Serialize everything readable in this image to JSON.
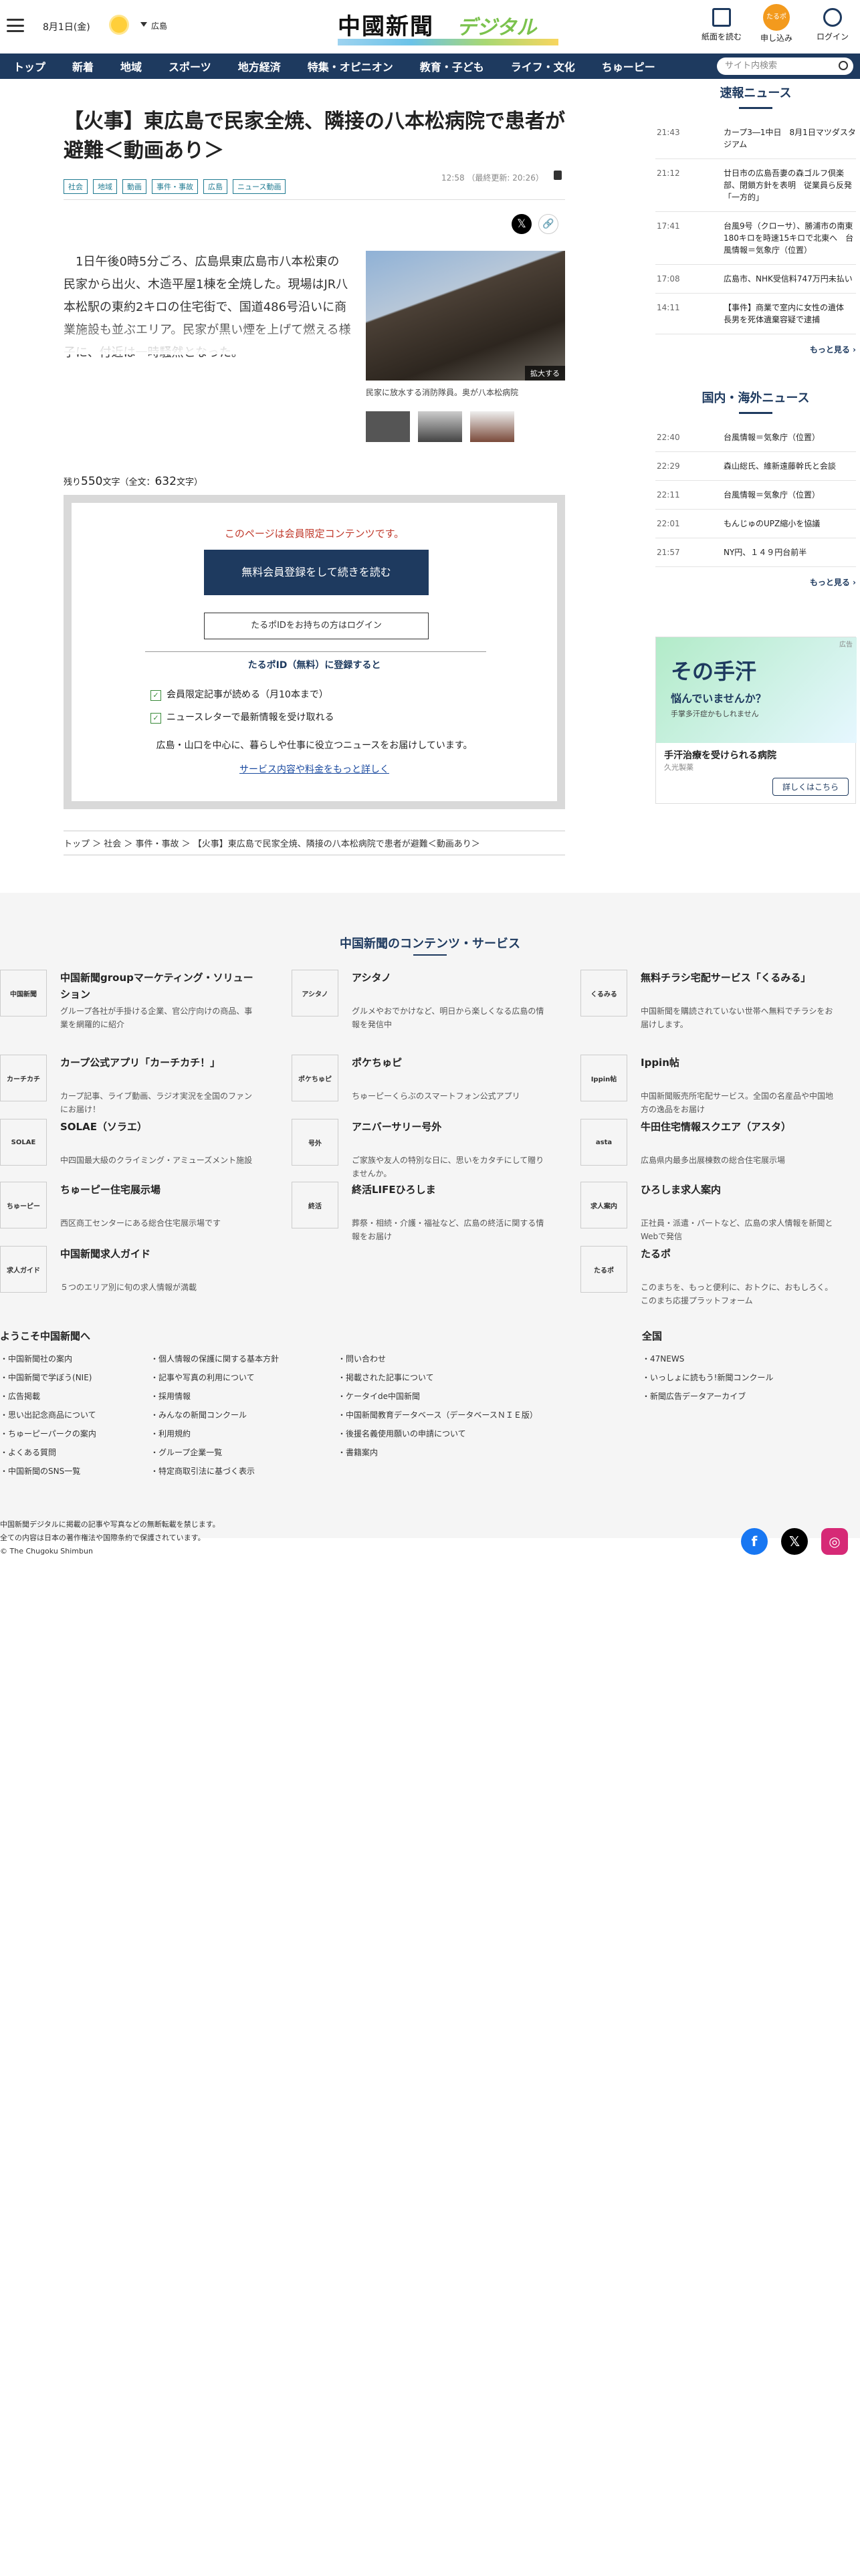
{
  "header": {
    "date": "8月1日(金)",
    "region": "広島",
    "logo_jp": "中國新聞",
    "logo_digital": "デジタル",
    "btn_read": "紙面を読む",
    "btn_apply": "申し込み",
    "btn_apply_badge": "たるポ",
    "btn_login": "ログイン"
  },
  "nav": {
    "items": [
      "トップ",
      "新着",
      "地域",
      "スポーツ",
      "地方経済",
      "特集・オピニオン",
      "教育・子ども",
      "ライフ・文化",
      "ちゅーピー"
    ],
    "search_placeholder": "サイト内検索"
  },
  "article": {
    "title": "【火事】東広島で民家全焼、隣接の八本松病院で患者が避難＜動画あり＞",
    "tags": [
      "社会",
      "地域",
      "動画",
      "事件・事故",
      "広島",
      "ニュース動画"
    ],
    "time": "12:58",
    "updated": "（最終更新: 20:26）",
    "body": "1日午後0時5分ごろ、広島県東広島市八本松東の民家から出火、木造平屋1棟を全焼した。現場はJR八本松駅の東約2キロの住宅街で、国道486号沿いに商業施設も並ぶエリア。民家が黒い煙を上げて燃える様子に、付近は一時騒然となった。",
    "photo_enlarge": "拡大する",
    "photo_caption": "民家に放水する消防隊員。奥が八本松病院",
    "remain_prefix": "残り",
    "remain_count": "550",
    "remain_mid": "文字（全文：",
    "total_count": "632",
    "remain_suffix": "文字）"
  },
  "paywall": {
    "title": "このページは会員限定コンテンツです。",
    "cta_primary": "無料会員登録をして続きを読む",
    "cta_secondary": "たるポIDをお持ちの方はログイン",
    "id_desc": "たるポID（無料）に登録すると",
    "benefits": [
      "会員限定記事が読める（月10本まで）",
      "ニュースレターで最新情報を受け取れる"
    ],
    "note": "広島・山口を中心に、暮らしや仕事に役立つニュースをお届けしています。",
    "link": "サービス内容や料金をもっと詳しく"
  },
  "breadcrumb": "トップ ＞ 社会 ＞ 事件・事故 ＞ 【火事】東広島で民家全焼、隣接の八本松病院で患者が避難＜動画あり＞",
  "sidebar": {
    "breaking_title": "速報ニュース",
    "breaking": [
      {
        "time": "21:43",
        "headline": "カープ3―1中日　8月1日マツダスタジアム"
      },
      {
        "time": "21:12",
        "headline": "廿日市の広島吾妻の森ゴルフ倶楽部、閉鎖方針を表明　従業員ら反発「一方的」"
      },
      {
        "time": "17:41",
        "headline": "台風9号（クローサ）、勝浦市の南東180キロを時速15キロで北東へ　台風情報＝気象庁（位置）"
      },
      {
        "time": "17:08",
        "headline": "広島市、NHK受信料747万円未払い"
      },
      {
        "time": "14:11",
        "headline": "【事件】商業で室内に女性の遺体　長男を死体遺棄容疑で逮捕"
      }
    ],
    "more": "もっと見る",
    "world_title": "国内・海外ニュース",
    "world": [
      {
        "time": "22:40",
        "headline": "台風情報＝気象庁（位置）"
      },
      {
        "time": "22:29",
        "headline": "森山総氏、維新遠藤幹氏と会談"
      },
      {
        "time": "22:11",
        "headline": "台風情報＝気象庁（位置）"
      },
      {
        "time": "22:01",
        "headline": "もんじゅのUPZ縮小を協議"
      },
      {
        "time": "21:57",
        "headline": "NY円、１４９円台前半"
      }
    ],
    "more2": "もっと見る",
    "ad": {
      "label": "広告",
      "big": "その手汗",
      "q": "悩んでいませんか？",
      "s": "手掌多汗症かもしれません",
      "title": "手汗治療を受けられる病院",
      "source": "久光製薬",
      "cta": "詳しくはこちら"
    }
  },
  "services": {
    "title": "中国新聞のコンテンツ・サービス",
    "items": [
      {
        "name": "中国新聞groupマーケティング・ソリューション",
        "desc": "グループ各社が手掛ける企業、官公庁向けの商品、事業を網羅的に紹介",
        "icon": "中国新聞"
      },
      {
        "name": "アシタノ",
        "desc": "グルメやおでかけなど、明日から楽しくなる広島の情報を発信中",
        "icon": "アシタノ"
      },
      {
        "name": "無料チラシ宅配サービス「くるみる」",
        "desc": "中国新聞を購読されていない世帯へ無料でチラシをお届けします。",
        "icon": "くるみる"
      },
      {
        "name": "カープ公式アプリ「カーチカチ！」",
        "desc": "カープ記事、ライブ動画、ラジオ実況を全国のファンにお届け！",
        "icon": "カーチカチ"
      },
      {
        "name": "ポケちゅピ",
        "desc": "ちゅーピーくらぶのスマートフォン公式アプリ",
        "icon": "ポケちゅピ"
      },
      {
        "name": "Ippin帖",
        "desc": "中国新聞販売所宅配サービス。全国の名産品や中国地方の逸品をお届け",
        "icon": "Ippin帖"
      },
      {
        "name": "SOLAE（ソラエ）",
        "desc": "中四国最大級のクライミング・アミューズメント施設",
        "icon": "SOLAE"
      },
      {
        "name": "アニバーサリー号外",
        "desc": "ご家族や友人の特別な日に、思いをカタチにして贈りませんか。",
        "icon": "号外"
      },
      {
        "name": "牛田住宅情報スクエア（アスタ）",
        "desc": "広島県内最多出展棟数の総合住宅展示場",
        "icon": "asta"
      },
      {
        "name": "ちゅーピー住宅展示場",
        "desc": "西区商工センターにある総合住宅展示場です",
        "icon": "ちゅーピー"
      },
      {
        "name": "終活LIFEひろしま",
        "desc": "葬祭・相続・介護・福祉など、広島の終活に関する情報をお届け",
        "icon": "終活"
      },
      {
        "name": "ひろしま求人案内",
        "desc": "正社員・派遣・パートなど、広島の求人情報を新聞とWebで発信",
        "icon": "求人案内"
      },
      {
        "name": "中国新聞求人ガイド",
        "desc": "５つのエリア別に旬の求人情報が満載",
        "icon": "求人ガイド"
      },
      {
        "name": "",
        "desc": "",
        "icon": ""
      },
      {
        "name": "たるポ",
        "desc": "このまちを、もっと便利に、おトクに、おもしろく。このまち応援プラットフォーム",
        "icon": "たるポ"
      }
    ]
  },
  "footer": {
    "welcome_title": "ようこそ中国新聞へ",
    "col1": [
      "中国新聞社の案内",
      "中国新聞で学ぼう(NIE)",
      "広告掲載",
      "思い出記念商品について",
      "ちゅーピーパークの案内",
      "よくある質問",
      "中国新聞のSNS一覧"
    ],
    "col2": [
      "個人情報の保護に関する基本方針",
      "記事や写真の利用について",
      "採用情報",
      "みんなの新聞コンクール",
      "利用規約",
      "グループ企業一覧",
      "特定商取引法に基づく表示"
    ],
    "col3": [
      "問い合わせ",
      "掲載された記事について",
      "ケータイde中国新聞",
      "中国新聞教育データベース（データベースＮＩＥ版）",
      "後援名義使用願いの申請について",
      "書籍案内"
    ],
    "national_title": "全国",
    "col4": [
      "47NEWS",
      "いっしょに読もう!新聞コンクール",
      "新聞広告データアーカイブ"
    ],
    "copy1": "中国新聞デジタルに掲載の記事や写真などの無断転載を禁じます。",
    "copy2": "全ての内容は日本の著作権法や国際条約で保護されています。",
    "copy3": "© The Chugoku Shimbun",
    "colors": {
      "facebook": "#1877f2",
      "x": "#000000",
      "instagram": "#d62976"
    }
  }
}
